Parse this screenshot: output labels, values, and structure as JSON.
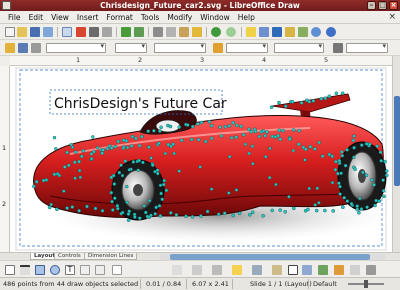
{
  "window": {
    "title": "Chrisdesign_Future_car2.svg - LibreOffice Draw"
  },
  "menu": [
    "File",
    "Edit",
    "View",
    "Insert",
    "Format",
    "Tools",
    "Modify",
    "Window",
    "Help"
  ],
  "ruler": {
    "h_ticks": [
      "1",
      "2",
      "3",
      "4",
      "5"
    ],
    "v_ticks": [
      "1",
      "2"
    ]
  },
  "canvas": {
    "drawing_title": "ChrisDesign's Future Car"
  },
  "sheet_tabs": [
    "Layout",
    "Controls",
    "Dimension Lines"
  ],
  "status": {
    "selection": "486 points from 44 draw objects selected",
    "position": "0.01 / 0.84",
    "size": "6.07 x 2.41",
    "slide": "Slide 1 / 1 (Layout)",
    "style": "Default"
  },
  "icons": [
    "new-icon",
    "open-icon",
    "save-icon",
    "print-icon",
    "cut-icon",
    "copy-icon",
    "paste-icon",
    "undo-icon",
    "redo-icon",
    "zoom-icon",
    "help-icon",
    "select-arrow-icon",
    "line-icon",
    "rectangle-icon",
    "ellipse-icon",
    "text-icon",
    "curve-icon",
    "star-icon",
    "points-icon",
    "close-icon"
  ],
  "colors": {
    "titlebar": "#7f2422",
    "car_body": "#d61e1e",
    "selection_points": "#2ac7c2",
    "scroll_thumb": "#4a7ab8"
  }
}
